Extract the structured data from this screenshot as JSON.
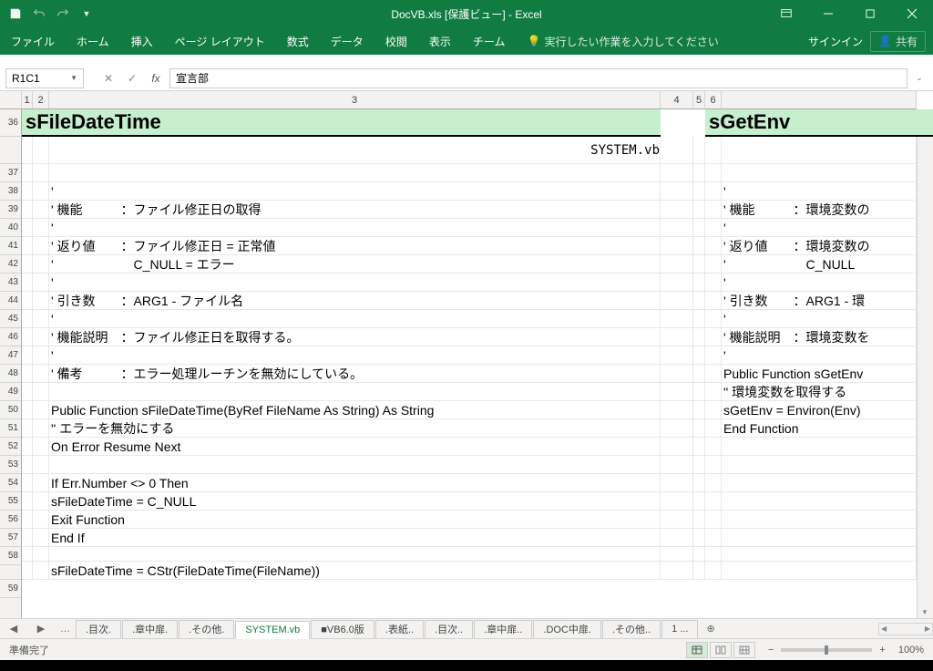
{
  "title": "DocVB.xls  [保護ビュー] - Excel",
  "qat": {
    "save": "save",
    "undo": "undo",
    "redo": "redo"
  },
  "win": {
    "restore": "restore",
    "min": "min",
    "max": "max",
    "close": "close"
  },
  "ribbon": {
    "tabs": [
      "ファイル",
      "ホーム",
      "挿入",
      "ページ レイアウト",
      "数式",
      "データ",
      "校閲",
      "表示",
      "チーム"
    ],
    "tell_me": "実行したい作業を入力してください",
    "signin": "サインイン",
    "share": "共有"
  },
  "fbar": {
    "name": "R1C1",
    "value": "宣言部"
  },
  "cols": {
    "c1": "1",
    "c2": "2",
    "c3": "3",
    "c4": "4",
    "c5": "5",
    "c6": "6"
  },
  "rows": [
    "36",
    "",
    "37",
    "38",
    "39",
    "40",
    "41",
    "42",
    "43",
    "44",
    "45",
    "46",
    "47",
    "48",
    "49",
    "50",
    "51",
    "52",
    "53",
    "54",
    "55",
    "56",
    "57",
    "58",
    "",
    "59"
  ],
  "hdr_a": "sFileDateTime",
  "hdr_b": "sGetEnv",
  "file_label": "SYSTEM.vb",
  "code_a": {
    "l38": "'",
    "l39": "' 機能　　　：ファイル修正日の取得",
    "l40": "'",
    "l41": "' 返り値　　：ファイル修正日 = 正常値",
    "l42": "'　　　　　　 C_NULL         = エラー",
    "l43": "'",
    "l44": "' 引き数　　：ARG1 - ファイル名",
    "l45": "'",
    "l46": "' 機能説明　：ファイル修正日を取得する。",
    "l47": "'",
    "l48": "' 備考　　　：エラー処理ルーチンを無効にしている。",
    "l49": "",
    "l50": "Public Function sFileDateTime(ByRef FileName As String) As String",
    "l51": "'' エラーを無効にする",
    "l52": "On Error Resume Next",
    "l53": "",
    "l54": " If Err.Number <> 0 Then",
    "l55": "    sFileDateTime = C_NULL",
    "l56": "    Exit Function",
    "l57": " End If",
    "l58": "",
    "l59": " sFileDateTime = CStr(FileDateTime(FileName))"
  },
  "code_b": {
    "l38": "'",
    "l39": "' 機能　　　：環境変数の",
    "l40": "'",
    "l41": "' 返り値　　：環境変数の",
    "l42": "'　　　　　　 C_NULL",
    "l43": "'",
    "l44": "' 引き数　　：ARG1 - 環",
    "l45": "'",
    "l46": "' 機能説明　：環境変数を",
    "l47": "'",
    "l48": "Public Function sGetEnv",
    "l49": "'' 環境変数を取得する",
    "l50": " sGetEnv = Environ(Env)",
    "l51": "End Function"
  },
  "sheets": {
    "list": [
      ".目次.",
      ".章中扉.",
      ".その他.",
      "SYSTEM.vb",
      "■VB6.0版",
      ".表紙..",
      ".目次..",
      ".章中扉..",
      ".DOC中扉.",
      ".その他.."
    ],
    "more": "1  ...",
    "active_index": 3
  },
  "status": {
    "ready": "準備完了",
    "zoom": "100%"
  }
}
